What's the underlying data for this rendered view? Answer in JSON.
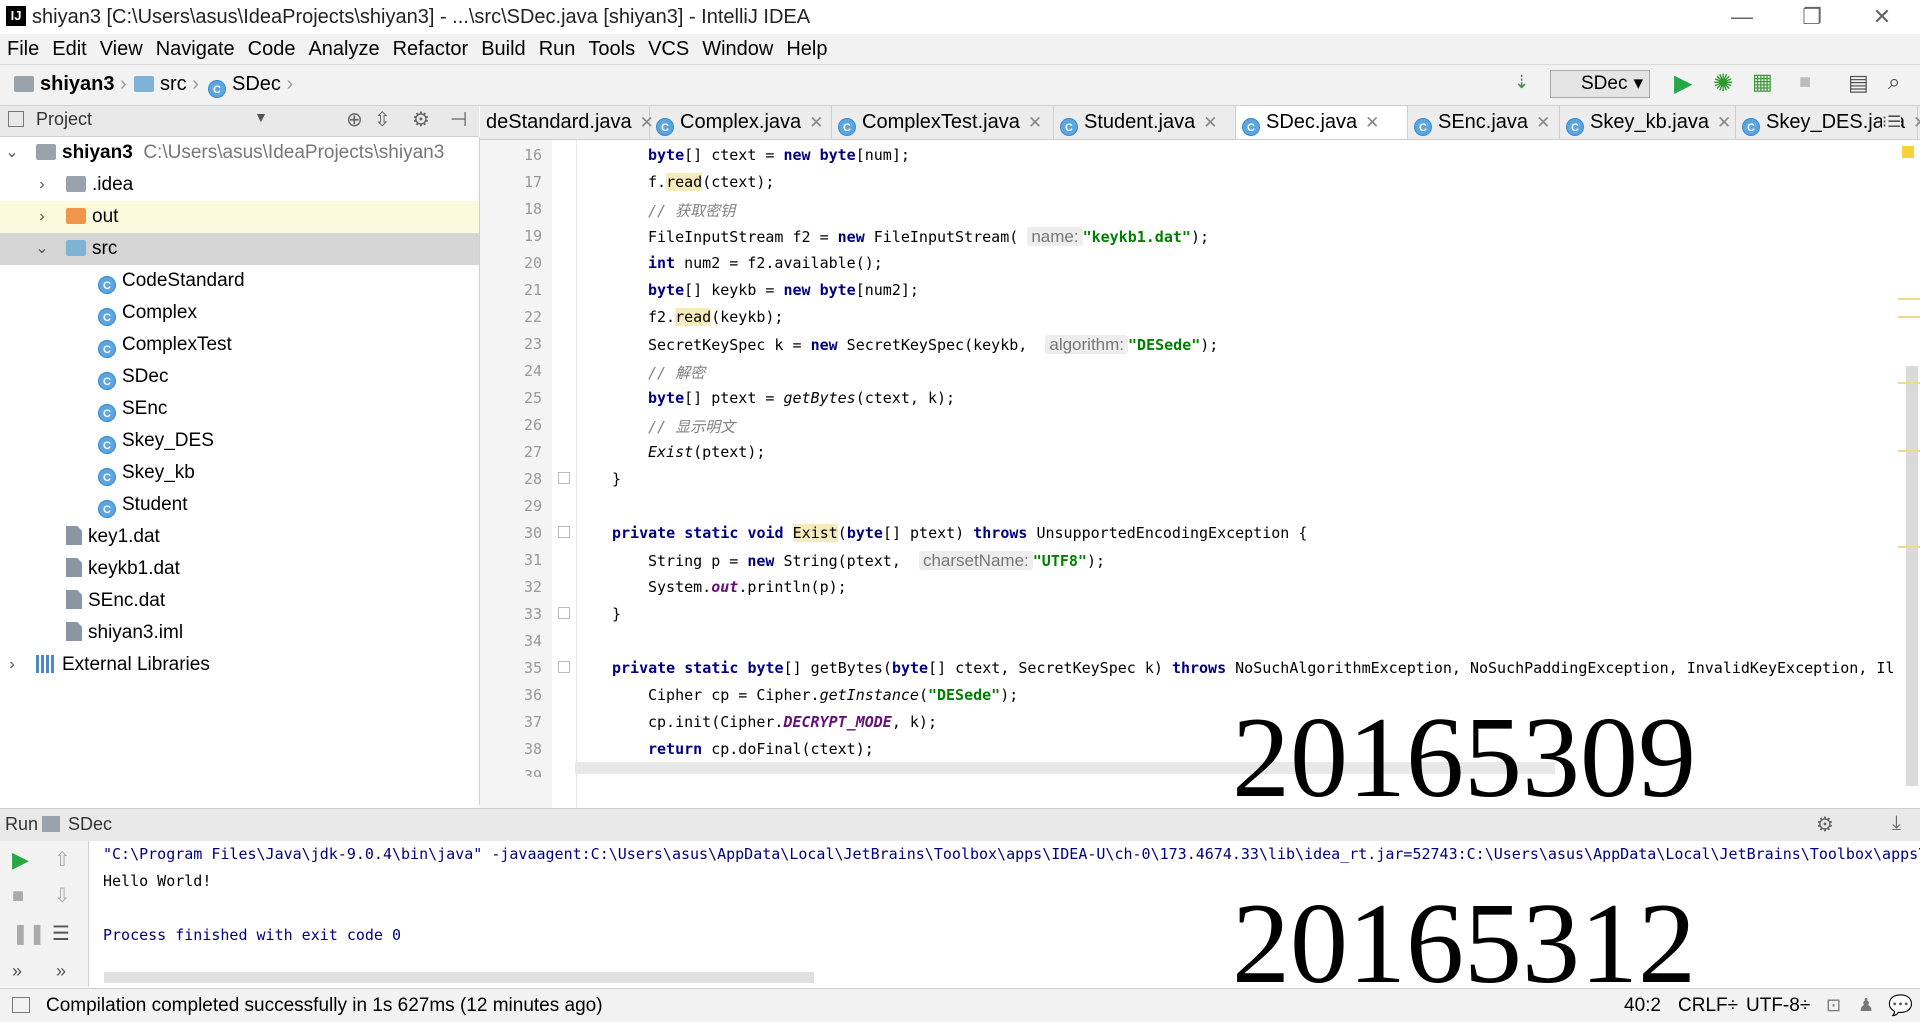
{
  "window": {
    "title": "shiyan3 [C:\\Users\\asus\\IdeaProjects\\shiyan3] - ...\\src\\SDec.java [shiyan3] - IntelliJ IDEA",
    "logo_text": "IJ"
  },
  "menu": [
    "File",
    "Edit",
    "View",
    "Navigate",
    "Code",
    "Analyze",
    "Refactor",
    "Build",
    "Run",
    "Tools",
    "VCS",
    "Window",
    "Help"
  ],
  "breadcrumb": [
    "shiyan3",
    "src",
    "SDec"
  ],
  "run_config": "SDec",
  "project_panel": {
    "title": "Project",
    "tree": [
      {
        "label": "shiyan3",
        "path": "C:\\Users\\asus\\IdeaProjects\\shiyan3"
      },
      {
        "label": ".idea"
      },
      {
        "label": "out"
      },
      {
        "label": "src"
      },
      {
        "label": "CodeStandard"
      },
      {
        "label": "Complex"
      },
      {
        "label": "ComplexTest"
      },
      {
        "label": "SDec"
      },
      {
        "label": "SEnc"
      },
      {
        "label": "Skey_DES"
      },
      {
        "label": "Skey_kb"
      },
      {
        "label": "Student"
      },
      {
        "label": "key1.dat"
      },
      {
        "label": "keykb1.dat"
      },
      {
        "label": "SEnc.dat"
      },
      {
        "label": "shiyan3.iml"
      },
      {
        "label": "External Libraries"
      }
    ]
  },
  "tabs": [
    "deStandard.java",
    "Complex.java",
    "ComplexTest.java",
    "Student.java",
    "SDec.java",
    "SEnc.java",
    "Skey_kb.java",
    "Skey_DES.java"
  ],
  "line_numbers": [
    "16",
    "17",
    "18",
    "19",
    "20",
    "21",
    "22",
    "23",
    "24",
    "25",
    "26",
    "27",
    "28",
    "29",
    "30",
    "31",
    "32",
    "33",
    "34",
    "35",
    "36",
    "37",
    "38",
    "39"
  ],
  "code": {
    "l16": {
      "a": "byte",
      "b": "[] ctext = ",
      "c": "new",
      "d": " ",
      "e": "byte",
      "f": "[num];"
    },
    "l17": {
      "a": "f.",
      "b": "read",
      "c": "(ctext);"
    },
    "l18": {
      "a": "// 获取密钥"
    },
    "l19": {
      "a": "FileInputStream f2 = ",
      "b": "new",
      "c": " FileInputStream( ",
      "hint": "name:",
      "s": "\"keykb1.dat\"",
      "d": ");"
    },
    "l20": {
      "a": "int",
      "b": " num2 = f2.available();"
    },
    "l21": {
      "a": "byte",
      "b": "[] keykb = ",
      "c": "new",
      "d": " ",
      "e": "byte",
      "f": "[num2];"
    },
    "l22": {
      "a": "f2.",
      "b": "read",
      "c": "(keykb);"
    },
    "l23": {
      "a": "SecretKeySpec k = ",
      "b": "new",
      "c": " SecretKeySpec(keykb,  ",
      "hint": "algorithm:",
      "s": "\"DESede\"",
      "d": ");"
    },
    "l24": {
      "a": "// 解密"
    },
    "l25": {
      "a": "byte",
      "b": "[] ptext = ",
      "c": "getBytes",
      "d": "(ctext, k);"
    },
    "l26": {
      "a": "// 显示明文"
    },
    "l27": {
      "a": "Exist",
      "b": "(ptext);"
    },
    "l28": {
      "a": "}"
    },
    "l30": {
      "a": "private static void",
      "b": " ",
      "c": "Exist",
      "d": "(",
      "e": "byte",
      "f": "[] ptext) ",
      "g": "throws",
      "h": " UnsupportedEncodingException {"
    },
    "l31": {
      "a": "String p = ",
      "b": "new",
      "c": " String(ptext,  ",
      "hint": "charsetName:",
      "s": "\"UTF8\"",
      "d": ");"
    },
    "l32": {
      "a": "System.",
      "b": "out",
      "c": ".println(p);"
    },
    "l33": {
      "a": "}"
    },
    "l35": {
      "a": "private static",
      "b": " ",
      "c": "byte",
      "d": "[] getBytes(",
      "e": "byte",
      "f": "[] ctext, SecretKeySpec k) ",
      "g": "throws",
      "h": " NoSuchAlgorithmException, NoSuchPaddingException, InvalidKeyException, Il"
    },
    "l36": {
      "a": "Cipher cp = Cipher.",
      "b": "getInstance",
      "c": "(",
      "s": "\"DESede\"",
      "d": ");"
    },
    "l37": {
      "a": "cp.init(Cipher.",
      "b": "DECRYPT_MODE",
      "c": ", k);"
    },
    "l38": {
      "a": "return",
      "b": " cp.doFinal(ctext);"
    }
  },
  "run_panel": {
    "label": "Run",
    "config": "SDec",
    "output": [
      "\"C:\\Program Files\\Java\\jdk-9.0.4\\bin\\java\" -javaagent:C:\\Users\\asus\\AppData\\Local\\JetBrains\\Toolbox\\apps\\IDEA-U\\ch-0\\173.4674.33\\lib\\idea_rt.jar=52743:C:\\Users\\asus\\AppData\\Local\\JetBrains\\Toolbox\\apps\\",
      "Hello World!",
      "",
      "Process finished with exit code 0"
    ]
  },
  "watermarks": [
    "20165309",
    "20165312"
  ],
  "status": {
    "message": "Compilation completed successfully in 1s 627ms (12 minutes ago)",
    "position": "40:2",
    "line_sep": "CRLF÷",
    "encoding": "UTF-8÷"
  },
  "colors": {
    "keyword": "#000080",
    "string": "#008000",
    "comment": "#808080",
    "field": "#660e7a",
    "accent": "#1e90ff"
  }
}
